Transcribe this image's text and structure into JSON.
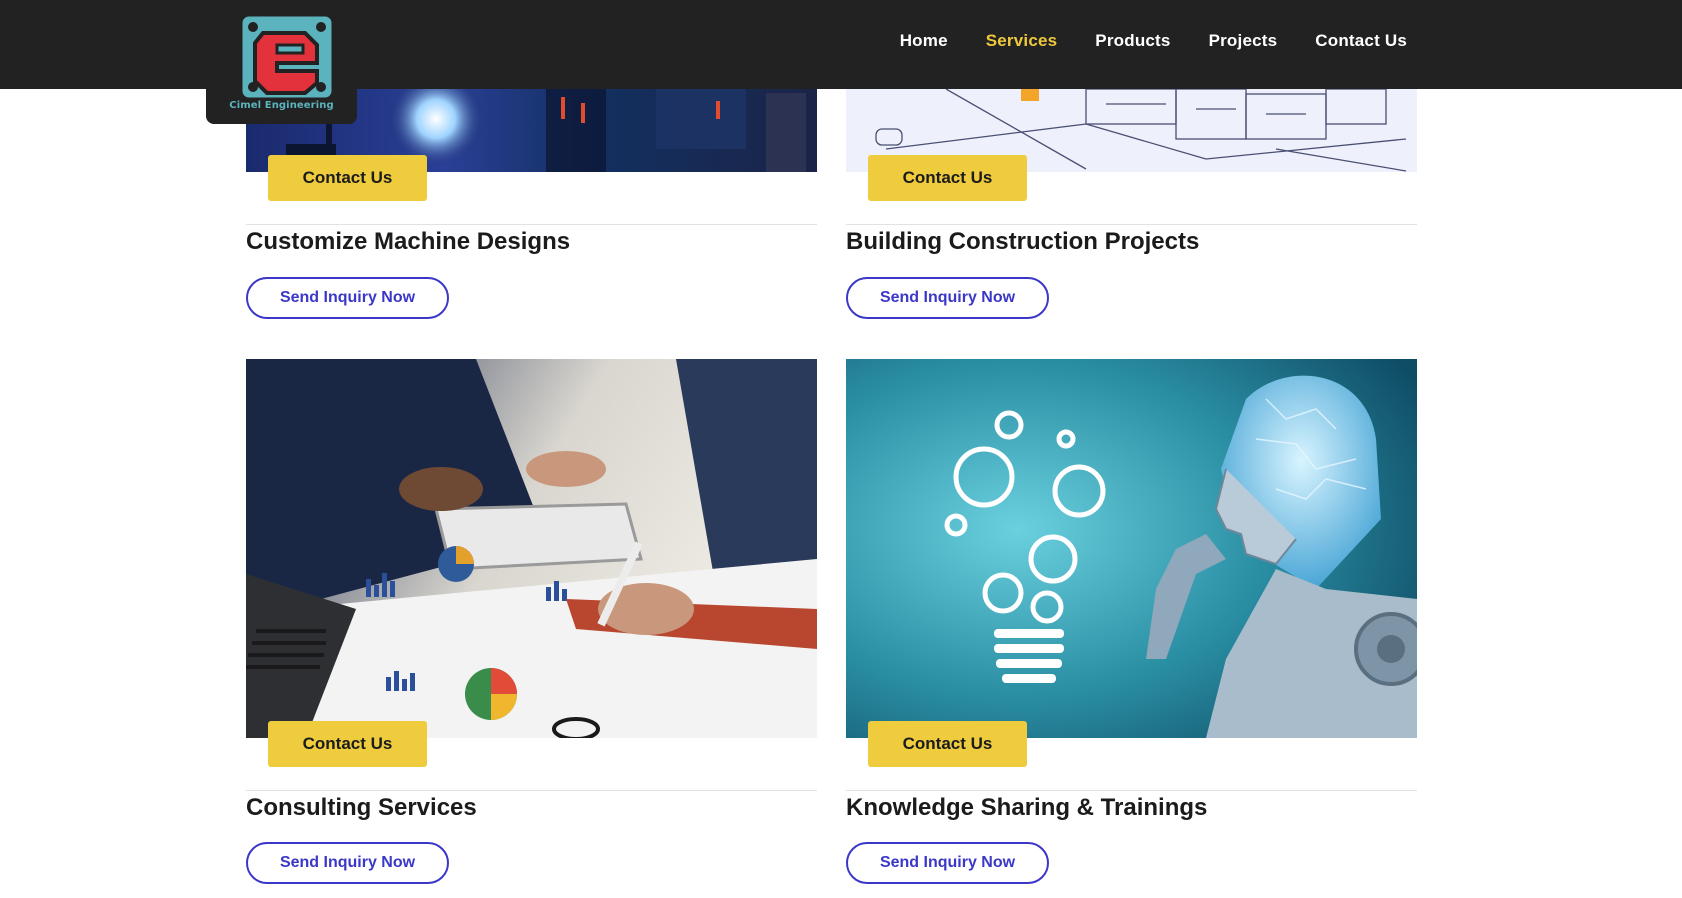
{
  "header": {
    "logo_text": "Cimel Engineering",
    "nav": [
      {
        "label": "Home",
        "active": false
      },
      {
        "label": "Services",
        "active": true
      },
      {
        "label": "Products",
        "active": false
      },
      {
        "label": "Projects",
        "active": false
      },
      {
        "label": "Contact Us",
        "active": false
      }
    ]
  },
  "cards": [
    {
      "title": "Customize Machine Designs",
      "cta_label": "Contact Us",
      "inquiry_label": "Send Inquiry Now",
      "image": "machine-workshop-image"
    },
    {
      "title": "Building Construction Projects",
      "cta_label": "Contact Us",
      "inquiry_label": "Send Inquiry Now",
      "image": "blueprint-image"
    },
    {
      "title": "Consulting Services",
      "cta_label": "Contact Us",
      "inquiry_label": "Send Inquiry Now",
      "image": "business-meeting-image"
    },
    {
      "title": "Knowledge Sharing & Trainings",
      "cta_label": "Contact Us",
      "inquiry_label": "Send Inquiry Now",
      "image": "ai-robot-image"
    }
  ],
  "colors": {
    "header_bg": "#222222",
    "nav_active": "#efc93c",
    "cta_bg": "#efcb3e",
    "inquiry_border": "#3b37c8",
    "logo_teal": "#5bb3bd",
    "logo_red": "#e3323c"
  }
}
